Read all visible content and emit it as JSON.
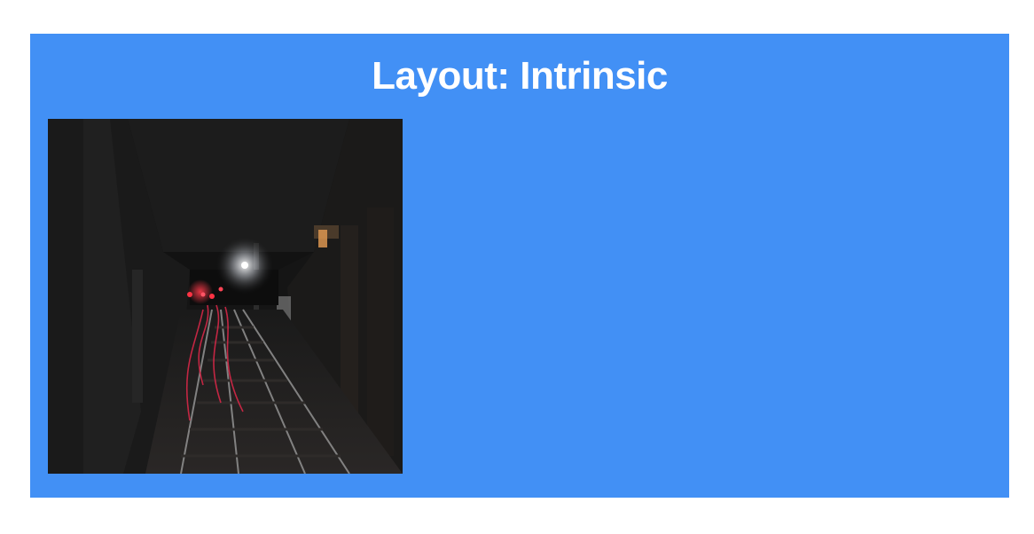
{
  "page": {
    "title": "Layout: Intrinsic"
  },
  "image": {
    "subject": "tunnel-railway-photo"
  },
  "colors": {
    "panel_background": "#4290f5",
    "page_background": "#ffffff",
    "title_text": "#ffffff"
  }
}
